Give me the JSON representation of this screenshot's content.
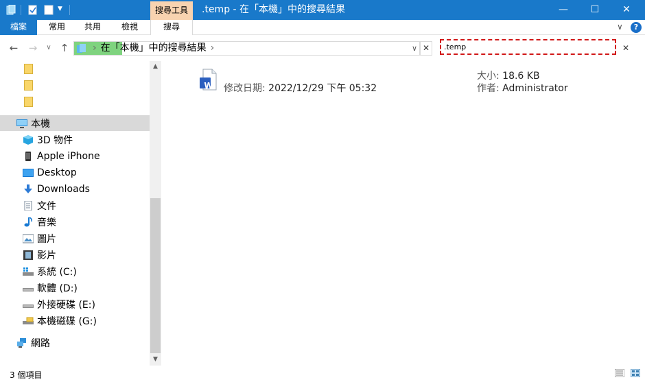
{
  "window": {
    "title": ".temp - 在「本機」中的搜尋結果",
    "context_tab": "搜尋工具",
    "minimize": "—",
    "maximize": "☐",
    "close": "✕"
  },
  "ribbon": {
    "tabs": [
      {
        "label": "檔案"
      },
      {
        "label": "常用"
      },
      {
        "label": "共用"
      },
      {
        "label": "檢視"
      },
      {
        "label": "搜尋"
      }
    ],
    "expand_glyph": "∨",
    "help_glyph": "?"
  },
  "navigation": {
    "back": "←",
    "forward": "→",
    "recent": "∨",
    "up": "↑",
    "breadcrumb": [
      "在「本機」中的搜尋結果"
    ],
    "separator": "›",
    "dropdown": "∨",
    "clear": "✕"
  },
  "search": {
    "value": ".temp",
    "clear": "✕"
  },
  "sidebar": {
    "items": [
      {
        "label": "本機",
        "icon": "computer-icon",
        "selected": true
      },
      {
        "label": "3D 物件",
        "icon": "3d-objects-icon"
      },
      {
        "label": "Apple iPhone",
        "icon": "phone-icon"
      },
      {
        "label": "Desktop",
        "icon": "desktop-icon"
      },
      {
        "label": "Downloads",
        "icon": "download-icon"
      },
      {
        "label": "文件",
        "icon": "document-icon"
      },
      {
        "label": "音樂",
        "icon": "music-icon"
      },
      {
        "label": "圖片",
        "icon": "picture-icon"
      },
      {
        "label": "影片",
        "icon": "video-icon"
      },
      {
        "label": "系統 (C:)",
        "icon": "system-drive-icon"
      },
      {
        "label": "軟體 (D:)",
        "icon": "drive-icon"
      },
      {
        "label": "外接硬碟 (E:)",
        "icon": "external-drive-icon"
      },
      {
        "label": "本機磁碟 (G:)",
        "icon": "local-disk-icon"
      },
      {
        "label": "網路",
        "icon": "network-icon"
      }
    ]
  },
  "result": {
    "modified_label": "修改日期:",
    "modified_value": "2022/12/29 下午 05:32",
    "size_label": "大小:",
    "size_value": "18.6 KB",
    "author_label": "作者:",
    "author_value": "Administrator",
    "icon_letter": "W"
  },
  "status": {
    "item_count": "3 個項目"
  },
  "colors": {
    "titlebar": "#1979ca",
    "context_tab": "#f8d3b0",
    "address_highlight": "#7fd37f",
    "search_outline": "#d11717",
    "selected_item": "#d9d9d9",
    "word_blue": "#2b5fbf"
  }
}
